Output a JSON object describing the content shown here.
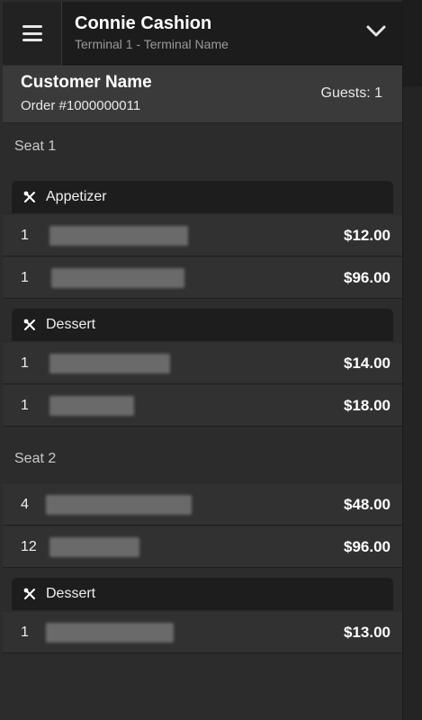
{
  "header": {
    "user_name": "Connie Cashion",
    "terminal": "Terminal 1 - Terminal Name"
  },
  "customer": {
    "name": "Customer Name",
    "order_number": "Order #1000000011",
    "guests": "Guests: 1"
  },
  "seats": [
    {
      "label": "Seat 1",
      "groups": [
        {
          "name": "Appetizer",
          "items": [
            {
              "qty": "1",
              "price": "$12.00"
            },
            {
              "qty": "1",
              "price": "$96.00"
            }
          ]
        },
        {
          "name": "Dessert",
          "items": [
            {
              "qty": "1",
              "price": "$14.00"
            },
            {
              "qty": "1",
              "price": "$18.00"
            }
          ]
        }
      ]
    },
    {
      "label": "Seat 2",
      "ungrouped_items": [
        {
          "qty": "4",
          "price": "$48.00"
        },
        {
          "qty": "12",
          "price": "$96.00"
        }
      ],
      "groups": [
        {
          "name": "Dessert",
          "items": [
            {
              "qty": "1",
              "price": "$13.00"
            }
          ]
        }
      ]
    }
  ],
  "icons": {
    "menu": "hamburger-menu-icon",
    "expand": "chevron-down-icon",
    "category": "fork-knife-icon"
  },
  "colors": {
    "topbar": "#1c1c1c",
    "customer_bar": "#3a3a3a",
    "row": "#313131",
    "group_header": "#1d1d1d"
  }
}
